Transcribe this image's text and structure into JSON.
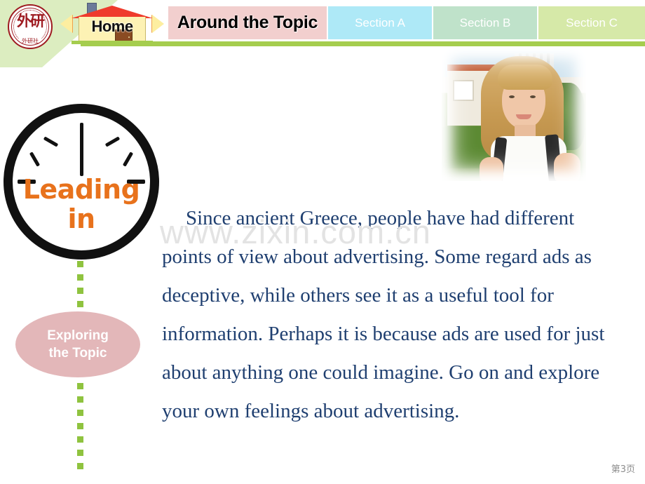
{
  "header": {
    "logo": {
      "mark_text": "外研",
      "publisher_cn": "外研社",
      "name": "fltrp-seal-logo"
    },
    "home": {
      "label": "Home",
      "prev_arrow": "◀",
      "next_arrow": "▶"
    },
    "tabs": [
      {
        "id": "around-the-topic",
        "label": "Around the Topic",
        "active": true,
        "color": "#f2cfce"
      },
      {
        "id": "section-a",
        "label": "Section A",
        "active": false,
        "color": "#aee9f7"
      },
      {
        "id": "section-b",
        "label": "Section B",
        "active": false,
        "color": "#bfe2ca"
      },
      {
        "id": "section-c",
        "label": "Section C",
        "active": false,
        "color": "#d6e9a8"
      }
    ]
  },
  "sidebar": {
    "clock": {
      "line1": "Leading",
      "line2": "in",
      "color": "#e8721c"
    },
    "oval": {
      "line1": "Exploring",
      "line2": "the Topic",
      "fill": "#e3b7b9",
      "text_color": "#ffffff"
    },
    "connector_color": "#8fc33f"
  },
  "main": {
    "paragraph": "Since ancient Greece, people have had different points of view about advertising. Some regard ads as deceptive, while others see it as a useful tool for information. Perhaps it is because ads are used for just about anything one could imagine. Go on and explore your own feelings about advertising.",
    "text_color": "#1f3f70",
    "photo_alt": "smiling-student-with-backpack"
  },
  "watermark": {
    "text": "www.zixin.com.cn"
  },
  "footer": {
    "page_label": "第3页"
  }
}
